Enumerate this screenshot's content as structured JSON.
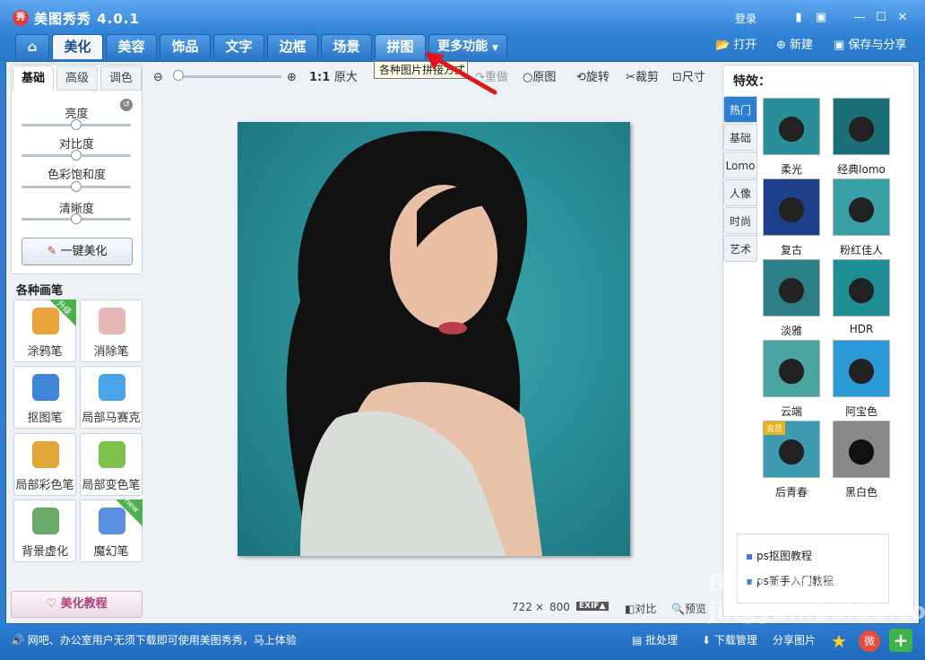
{
  "app": {
    "logo": "秀",
    "title": "美图秀秀 4.0.1",
    "login": "登录"
  },
  "window_controls": [
    "▮",
    "▣",
    "—",
    "☐",
    "✕"
  ],
  "tabs": {
    "home": "⌂",
    "items": [
      "美化",
      "美容",
      "饰品",
      "文字",
      "边框",
      "场景",
      "拼图",
      "更多功能"
    ]
  },
  "top_actions": {
    "open": "打开",
    "new": "新建",
    "save": "保存与分享"
  },
  "left": {
    "tabs": [
      "基础",
      "高级",
      "调色"
    ],
    "sliders": [
      "亮度",
      "对比度",
      "色彩饱和度",
      "清晰度"
    ],
    "onekey": "一键美化",
    "brushes_title": "各种画笔",
    "tools": [
      {
        "label": "涂鸦笔",
        "badge": "升级",
        "color": "#e8a33a"
      },
      {
        "label": "消除笔",
        "badge": "",
        "color": "#e7b6b6"
      },
      {
        "label": "抠图笔",
        "badge": "",
        "color": "#3f87d6"
      },
      {
        "label": "局部马赛克",
        "badge": "",
        "color": "#4aa3e6"
      },
      {
        "label": "局部彩色笔",
        "badge": "",
        "color": "#e0a63a"
      },
      {
        "label": "局部变色笔",
        "badge": "",
        "color": "#7cc24a"
      },
      {
        "label": "背景虚化",
        "badge": "",
        "color": "#6aa86a"
      },
      {
        "label": "魔幻笔",
        "badge": "new",
        "color": "#5a8fe0"
      }
    ],
    "tutorial": "美化教程"
  },
  "toolbar": {
    "zoom_ratio": "1:1",
    "original_size": "原大",
    "tooltip": "各种图片拼接方式",
    "redo": "重做",
    "original": "原图",
    "rotate": "旋转",
    "crop": "裁剪",
    "size": "尺寸"
  },
  "image_info": {
    "width": "722",
    "x": "×",
    "height": "800",
    "exif": "EXIF▲",
    "compare": "对比",
    "preview": "预览"
  },
  "effects": {
    "title": "特效：",
    "categories": [
      "热门",
      "基础",
      "Lomo",
      "人像",
      "时尚",
      "艺术"
    ],
    "items": [
      {
        "label": "柔光",
        "badge": ""
      },
      {
        "label": "经典lomo",
        "badge": ""
      },
      {
        "label": "复古",
        "badge": ""
      },
      {
        "label": "粉红佳人",
        "badge": ""
      },
      {
        "label": "淡雅",
        "badge": ""
      },
      {
        "label": "HDR",
        "badge": ""
      },
      {
        "label": "云端",
        "badge": ""
      },
      {
        "label": "阿宝色",
        "badge": ""
      },
      {
        "label": "后青春",
        "badge": "会员"
      },
      {
        "label": "黑白色",
        "badge": ""
      }
    ],
    "links": [
      "ps抠图教程",
      "ps新手入门教程"
    ]
  },
  "status": {
    "message": "网吧、办公室用户无须下载即可使用美图秀秀，马上体验",
    "batch": "批处理",
    "download": "下载管理",
    "share": "分享图片"
  },
  "watermark": "Baidu 经验 jingyan.baidu.com"
}
